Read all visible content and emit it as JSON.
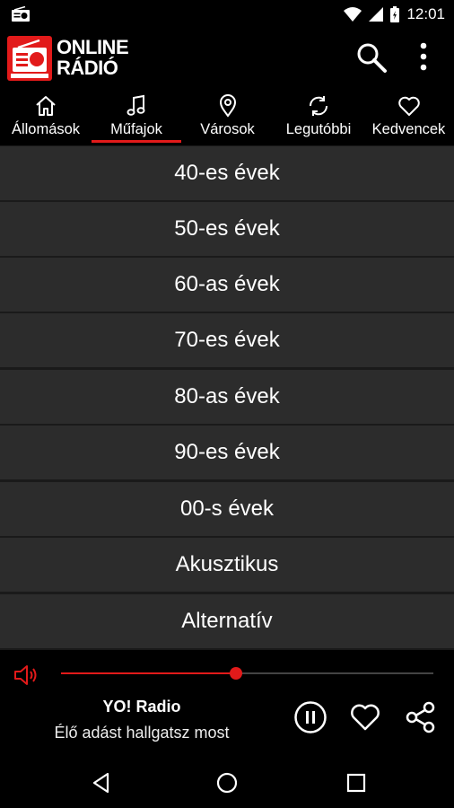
{
  "status": {
    "time": "12:01"
  },
  "app": {
    "brand_line1": "ONLINE",
    "brand_line2": "RÁDIÓ",
    "logo_text": "ONLINE RÁDIÓ"
  },
  "tabs": [
    {
      "label": "Állomások",
      "icon": "home-icon"
    },
    {
      "label": "Műfajok",
      "icon": "music-note-icon",
      "selected": true
    },
    {
      "label": "Városok",
      "icon": "location-pin-icon"
    },
    {
      "label": "Legutóbbi",
      "icon": "refresh-icon"
    },
    {
      "label": "Kedvencek",
      "icon": "heart-icon"
    }
  ],
  "genres": [
    "40-es évek",
    "50-es évek",
    "60-as évek",
    "70-es évek",
    "80-as évek",
    "90-es évek",
    "00-s évek",
    "Akusztikus",
    "Alternatív"
  ],
  "player": {
    "station": "YO! Radio",
    "status": "Élő adást hallgatsz most",
    "progress": 0.469
  },
  "colors": {
    "accent": "#e21a1a",
    "row_bg": "#2c2c2c",
    "divider": "#1a1a1a"
  }
}
